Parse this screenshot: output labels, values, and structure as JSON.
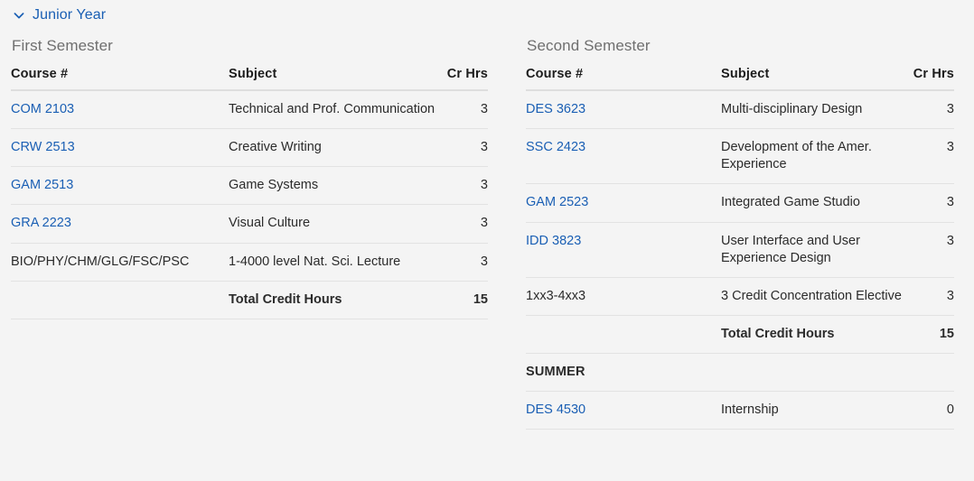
{
  "accordion": {
    "chevron_icon": "chevron-down-icon",
    "title": "Junior Year",
    "link_color": "#1a5fb4"
  },
  "columns": {
    "course": "Course #",
    "subject": "Subject",
    "hours": "Cr Hrs"
  },
  "first_semester": {
    "label": "First Semester",
    "rows": [
      {
        "course": "COM 2103",
        "is_link": true,
        "subject": "Technical and Prof. Communication",
        "hours": "3"
      },
      {
        "course": "CRW 2513",
        "is_link": true,
        "subject": "Creative Writing",
        "hours": "3"
      },
      {
        "course": "GAM 2513",
        "is_link": true,
        "subject": "Game Systems",
        "hours": "3"
      },
      {
        "course": "GRA 2223",
        "is_link": true,
        "subject": "Visual Culture",
        "hours": "3"
      },
      {
        "course": "BIO/PHY/CHM/GLG/FSC/PSC",
        "is_link": false,
        "subject": "1-4000 level Nat. Sci. Lecture",
        "hours": "3"
      }
    ],
    "total_label": "Total Credit Hours",
    "total_hours": "15"
  },
  "second_semester": {
    "label": "Second Semester",
    "rows": [
      {
        "course": "DES 3623",
        "is_link": true,
        "subject": "Multi-disciplinary Design",
        "hours": "3"
      },
      {
        "course": "SSC 2423",
        "is_link": true,
        "subject": "Development of the Amer. Experience",
        "hours": "3"
      },
      {
        "course": "GAM 2523",
        "is_link": true,
        "subject": "Integrated Game Studio",
        "hours": "3"
      },
      {
        "course": "IDD 3823",
        "is_link": true,
        "subject": "User Interface and User Experience Design",
        "hours": "3"
      },
      {
        "course": "1xx3-4xx3",
        "is_link": false,
        "subject": "3 Credit Concentration Elective",
        "hours": "3"
      }
    ],
    "total_label": "Total Credit Hours",
    "total_hours": "15",
    "summer": {
      "section_label": "SUMMER",
      "rows": [
        {
          "course": "DES 4530",
          "is_link": true,
          "subject": "Internship",
          "hours": "0"
        }
      ]
    }
  }
}
